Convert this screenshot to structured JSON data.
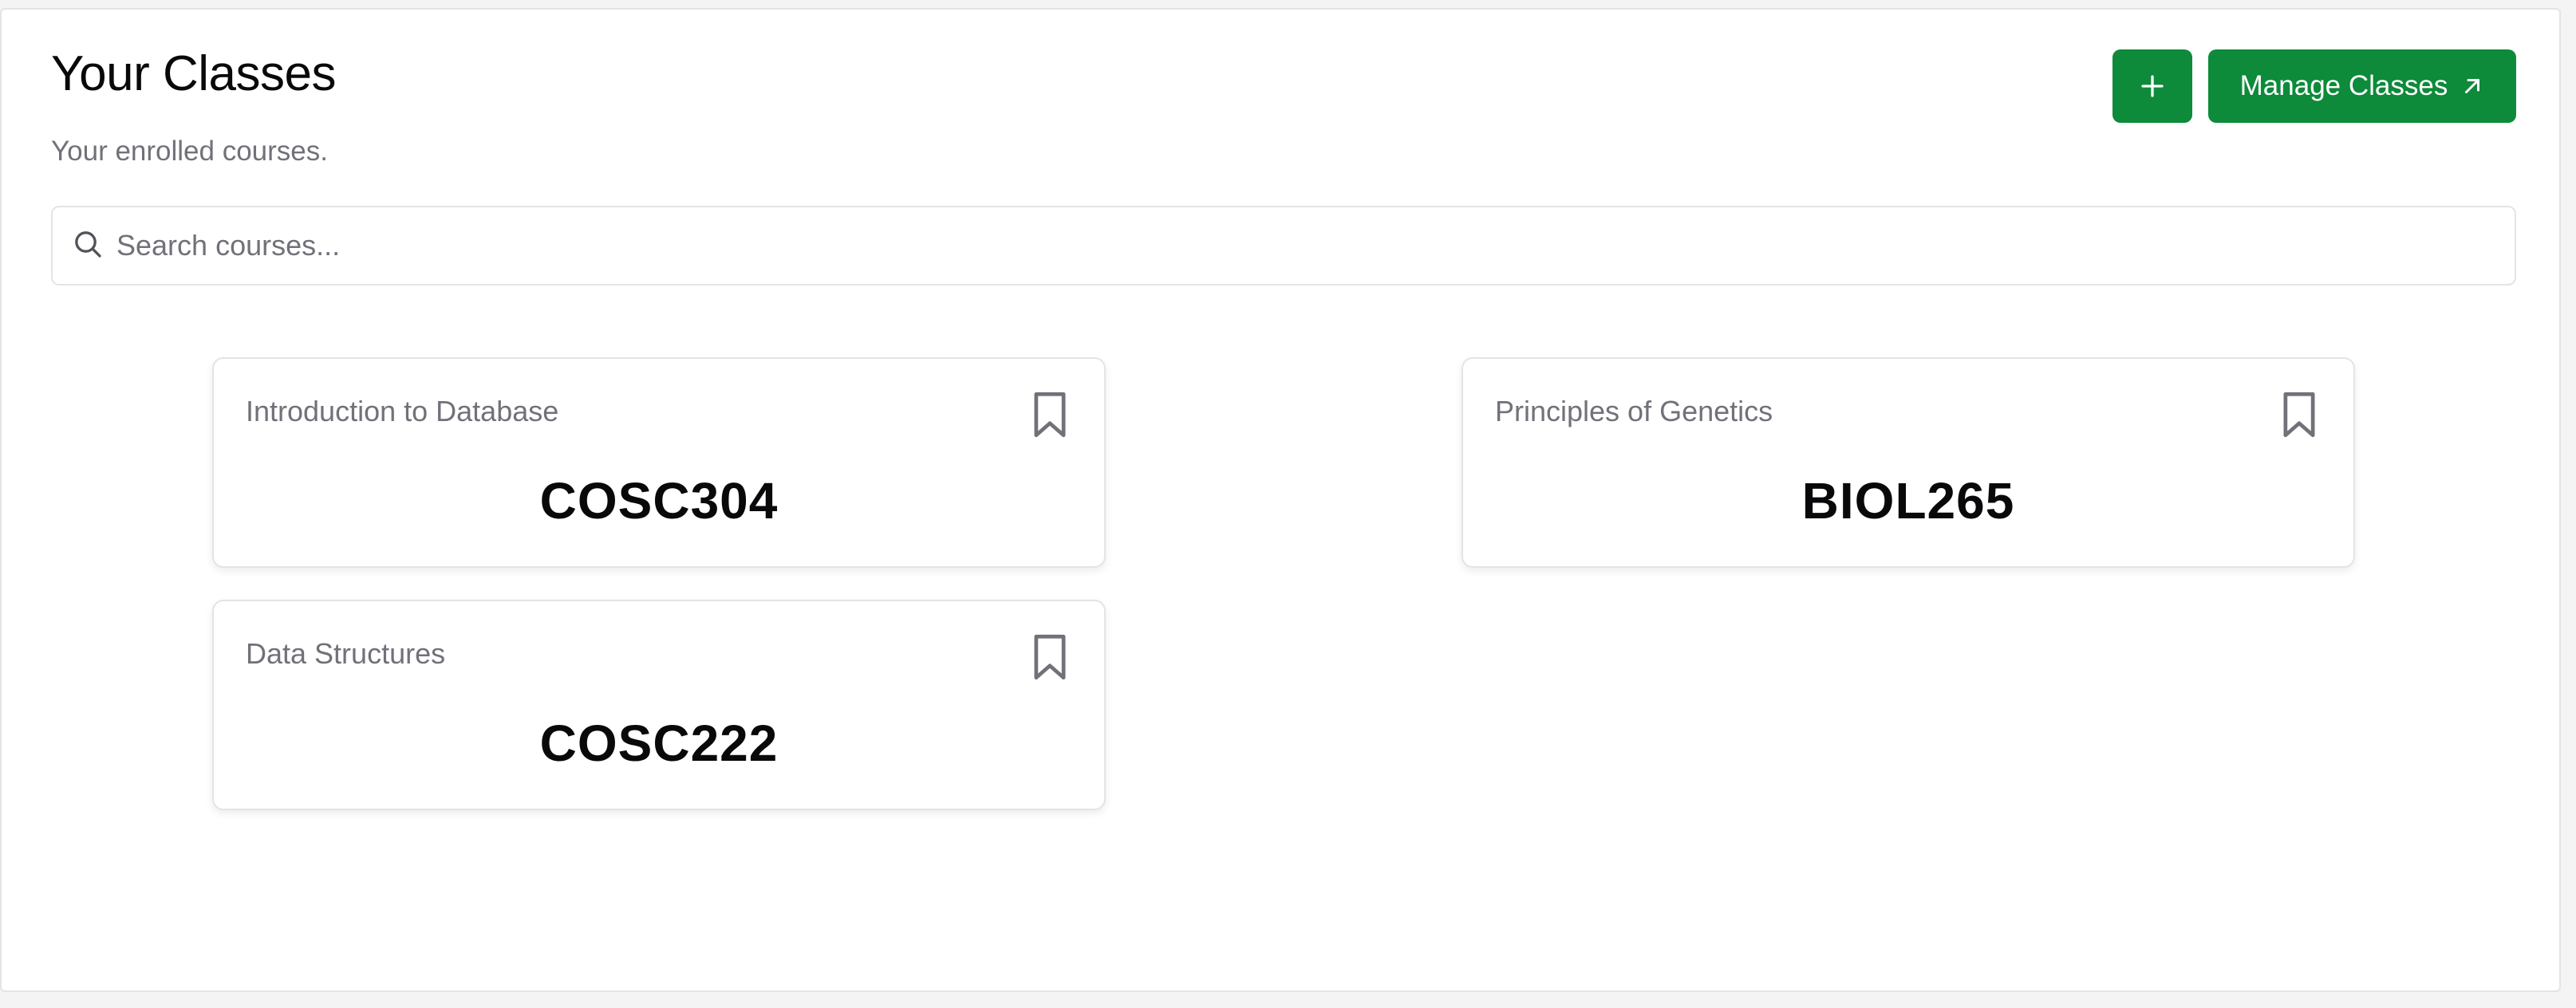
{
  "header": {
    "title": "Your Classes",
    "subtitle": "Your enrolled courses.",
    "add_label": "+",
    "manage_label": "Manage Classes"
  },
  "search": {
    "placeholder": "Search courses...",
    "value": ""
  },
  "courses": [
    {
      "name": "Introduction to Database",
      "code": "COSC304",
      "icon": "bookmark-icon"
    },
    {
      "name": "Principles of Genetics",
      "code": "BIOL265",
      "icon": "bookmark-icon"
    },
    {
      "name": "Data Structures",
      "code": "COSC222",
      "icon": "bookmark-icon"
    }
  ],
  "colors": {
    "accent": "#0d8a3a",
    "text_primary": "#09090b",
    "text_muted": "#71717a",
    "border": "#e4e4e7"
  },
  "icons": {
    "search": "search-icon",
    "add": "plus-icon",
    "external": "arrow-up-right-icon"
  }
}
